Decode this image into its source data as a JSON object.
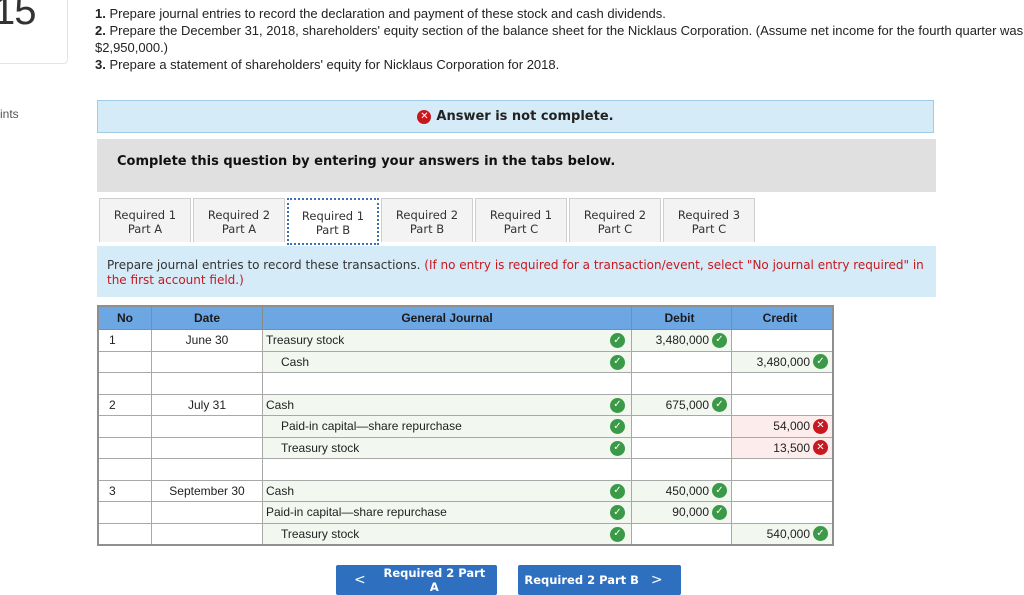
{
  "question_number": "15",
  "points_label": "ints",
  "instructions": [
    {
      "num": "1.",
      "text": " Prepare journal entries to record the declaration and payment of these stock and cash dividends."
    },
    {
      "num": "2.",
      "text": " Prepare the December 31, 2018, shareholders' equity section of the balance sheet for the Nicklaus Corporation. (Assume net income for the fourth quarter was $2,950,000.)"
    },
    {
      "num": "3.",
      "text": " Prepare a statement of shareholders' equity for Nicklaus Corporation for 2018."
    }
  ],
  "alert": {
    "text": "Answer is not complete.",
    "icon": "x-circle-icon"
  },
  "complete_prompt": "Complete this question by entering your answers in the tabs below.",
  "tabs": [
    {
      "line1": "Required 1",
      "line2": "Part A",
      "active": false
    },
    {
      "line1": "Required 2",
      "line2": "Part A",
      "active": false
    },
    {
      "line1": "Required 1",
      "line2": "Part B",
      "active": true
    },
    {
      "line1": "Required 2",
      "line2": "Part B",
      "active": false
    },
    {
      "line1": "Required 1",
      "line2": "Part C",
      "active": false
    },
    {
      "line1": "Required 2",
      "line2": "Part C",
      "active": false
    },
    {
      "line1": "Required 3",
      "line2": "Part C",
      "active": false
    }
  ],
  "task_instruction": {
    "main": "Prepare journal entries to record these transactions.",
    "note": "(If no entry is required for a transaction/event, select \"No journal entry required\" in the first account field.)"
  },
  "table": {
    "headers": {
      "no": "No",
      "date": "Date",
      "journal": "General Journal",
      "debit": "Debit",
      "credit": "Credit"
    },
    "rows": [
      {
        "no": "1",
        "date": "June 30",
        "account": "Treasury stock",
        "indent": false,
        "acct_status": "correct",
        "debit": "3,480,000",
        "debit_status": "correct",
        "credit": "",
        "credit_status": ""
      },
      {
        "no": "",
        "date": "",
        "account": "Cash",
        "indent": true,
        "acct_status": "correct",
        "debit": "",
        "debit_status": "",
        "credit": "3,480,000",
        "credit_status": "correct"
      },
      {
        "no": "",
        "date": "",
        "account": "",
        "indent": false,
        "acct_status": "",
        "debit": "",
        "debit_status": "",
        "credit": "",
        "credit_status": ""
      },
      {
        "no": "2",
        "date": "July 31",
        "account": "Cash",
        "indent": false,
        "acct_status": "correct",
        "debit": "675,000",
        "debit_status": "correct",
        "credit": "",
        "credit_status": ""
      },
      {
        "no": "",
        "date": "",
        "account": "Paid-in capital—share repurchase",
        "indent": true,
        "acct_status": "correct",
        "debit": "",
        "debit_status": "",
        "credit": "54,000",
        "credit_status": "incorrect"
      },
      {
        "no": "",
        "date": "",
        "account": "Treasury stock",
        "indent": true,
        "acct_status": "correct",
        "debit": "",
        "debit_status": "",
        "credit": "13,500",
        "credit_status": "incorrect"
      },
      {
        "no": "",
        "date": "",
        "account": "",
        "indent": false,
        "acct_status": "",
        "debit": "",
        "debit_status": "",
        "credit": "",
        "credit_status": ""
      },
      {
        "no": "3",
        "date": "September 30",
        "account": "Cash",
        "indent": false,
        "acct_status": "correct",
        "debit": "450,000",
        "debit_status": "correct",
        "credit": "",
        "credit_status": ""
      },
      {
        "no": "",
        "date": "",
        "account": "Paid-in capital—share repurchase",
        "indent": false,
        "acct_status": "correct",
        "debit": "90,000",
        "debit_status": "correct",
        "credit": "",
        "credit_status": ""
      },
      {
        "no": "",
        "date": "",
        "account": "Treasury stock",
        "indent": true,
        "acct_status": "correct",
        "debit": "",
        "debit_status": "",
        "credit": "540,000",
        "credit_status": "correct"
      }
    ]
  },
  "nav": {
    "prev_label": "Required 2 Part A",
    "prev_arrow": "<",
    "next_label": "Required 2 Part B",
    "next_arrow": ">"
  },
  "colors": {
    "correct": "#3b9a48",
    "incorrect": "#c8171e",
    "header_blue": "#6da7e3",
    "button_blue": "#2f6fc0",
    "info_bg": "#d6ebf8"
  }
}
